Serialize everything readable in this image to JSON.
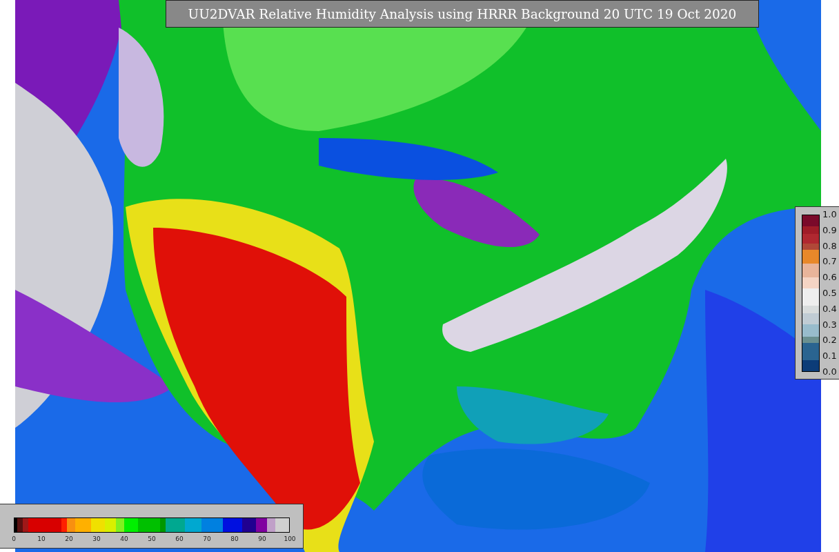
{
  "title": "UU2DVAR Relative Humidity Analysis using HRRR Background 20 UTC 19 Oct 2020",
  "side_colorbar": {
    "ticks": [
      "1.0",
      "0.9",
      "0.8",
      "0.7",
      "0.6",
      "0.5",
      "0.4",
      "0.3",
      "0.2",
      "0.1",
      "0.0"
    ]
  },
  "bottom_colorbar": {
    "ticks": [
      "0",
      "10",
      "20",
      "30",
      "40",
      "50",
      "60",
      "70",
      "80",
      "90",
      "100"
    ]
  }
}
